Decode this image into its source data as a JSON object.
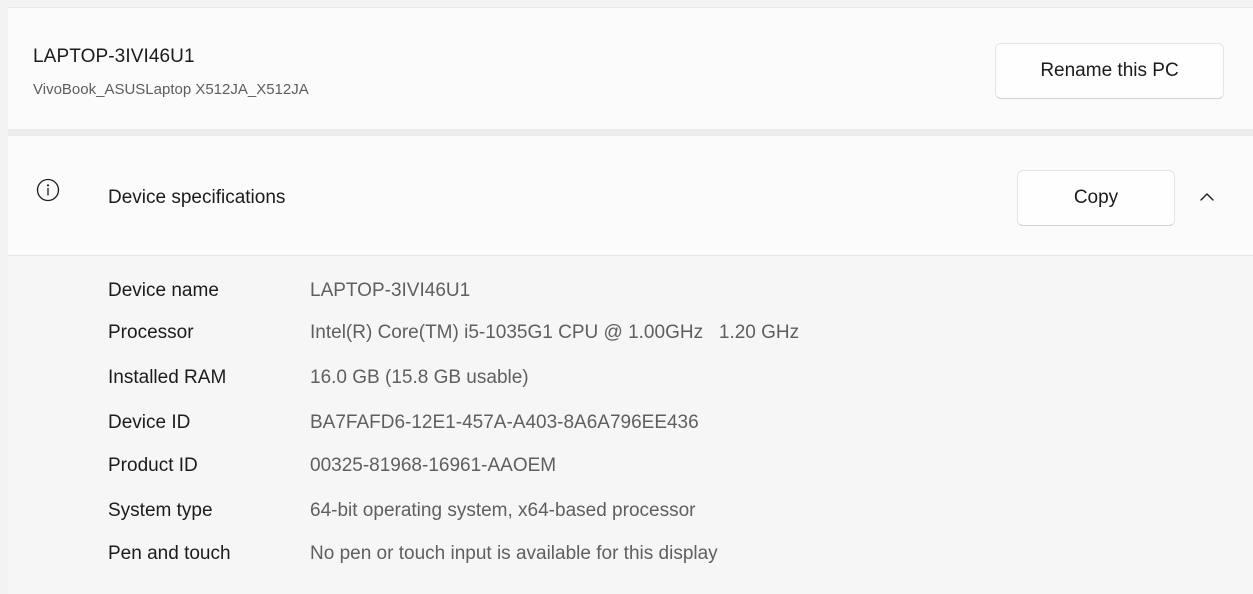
{
  "device": {
    "name": "LAPTOP-3IVI46U1",
    "model": "VivoBook_ASUSLaptop X512JA_X512JA",
    "rename_label": "Rename this PC"
  },
  "specifications": {
    "title": "Device specifications",
    "copy_label": "Copy",
    "icon": "info-icon",
    "expanded": true,
    "rows": [
      {
        "label": "Device name",
        "value": "LAPTOP-3IVI46U1"
      },
      {
        "label": "Processor",
        "value": "Intel(R) Core(TM) i5-1035G1 CPU @ 1.00GHz   1.20 GHz"
      },
      {
        "label": "Installed RAM",
        "value": "16.0 GB (15.8 GB usable)"
      },
      {
        "label": "Device ID",
        "value": "BA7FAFD6-12E1-457A-A403-8A6A796EE436"
      },
      {
        "label": "Product ID",
        "value": "00325-81968-16961-AAOEM"
      },
      {
        "label": "System type",
        "value": "64-bit operating system, x64-based processor"
      },
      {
        "label": "Pen and touch",
        "value": "No pen or touch input is available for this display"
      }
    ]
  }
}
